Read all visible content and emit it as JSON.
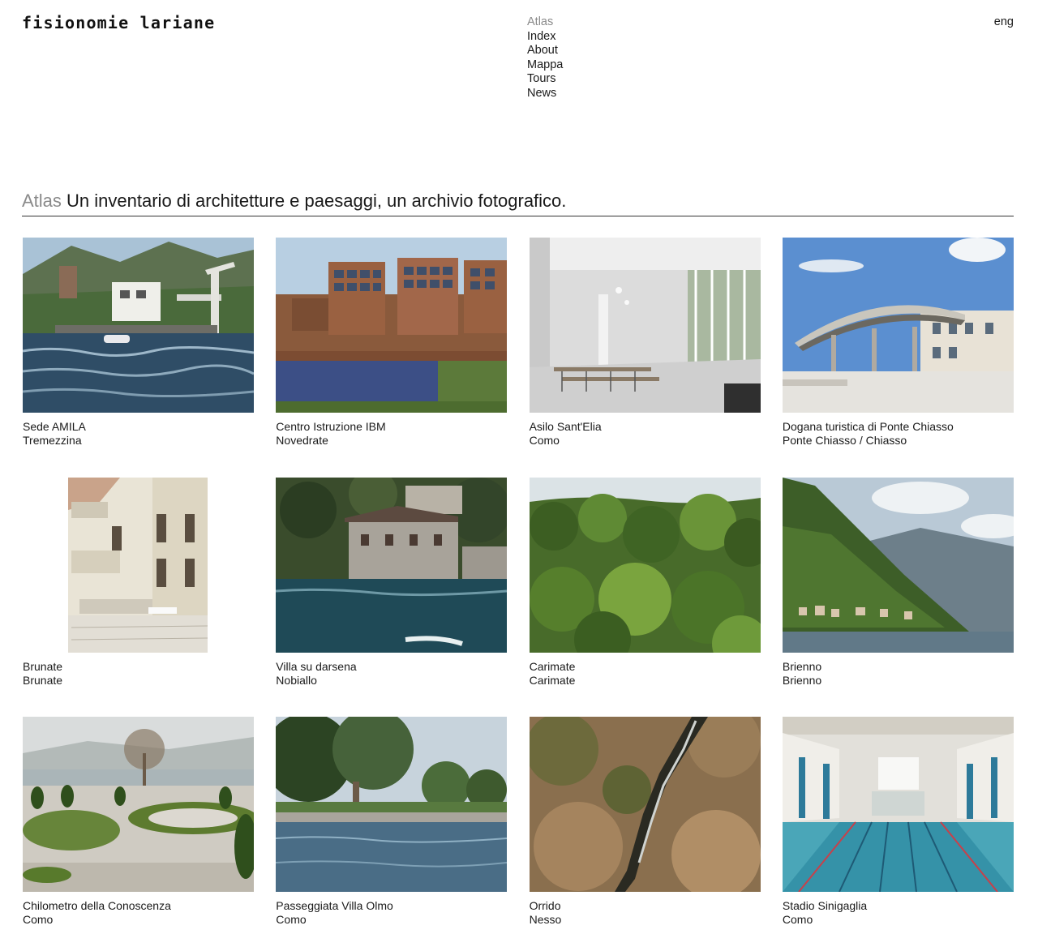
{
  "brand": {
    "name": "fisionomie lariane"
  },
  "nav": {
    "items": [
      {
        "label": "Atlas",
        "active": true
      },
      {
        "label": "Index",
        "active": false
      },
      {
        "label": "About",
        "active": false
      },
      {
        "label": "Mappa",
        "active": false
      },
      {
        "label": "Tours",
        "active": false
      },
      {
        "label": "News",
        "active": false
      }
    ],
    "language": "eng"
  },
  "intro": {
    "section": "Atlas",
    "text": "Un inventario di architetture e paesaggi, un archivio fotografico."
  },
  "colors": {
    "muted_text": "#8a8a8a",
    "text": "#1a1a1a",
    "rule": "#333333"
  },
  "atlas": {
    "entries": [
      {
        "title": "Sede AMILA",
        "location": "Tremezzina"
      },
      {
        "title": "Centro Istruzione IBM",
        "location": "Novedrate"
      },
      {
        "title": "Asilo Sant'Elia",
        "location": "Como"
      },
      {
        "title": "Dogana turistica di Ponte Chiasso",
        "location": "Ponte Chiasso / Chiasso"
      },
      {
        "title": "Brunate",
        "location": "Brunate"
      },
      {
        "title": "Villa su darsena",
        "location": "Nobiallo"
      },
      {
        "title": "Carimate",
        "location": "Carimate"
      },
      {
        "title": "Brienno",
        "location": "Brienno"
      },
      {
        "title": "Chilometro della Conoscenza",
        "location": "Como"
      },
      {
        "title": "Passeggiata Villa Olmo",
        "location": "Como"
      },
      {
        "title": "Orrido",
        "location": "Nesso"
      },
      {
        "title": "Stadio Sinigaglia",
        "location": "Como"
      }
    ]
  }
}
